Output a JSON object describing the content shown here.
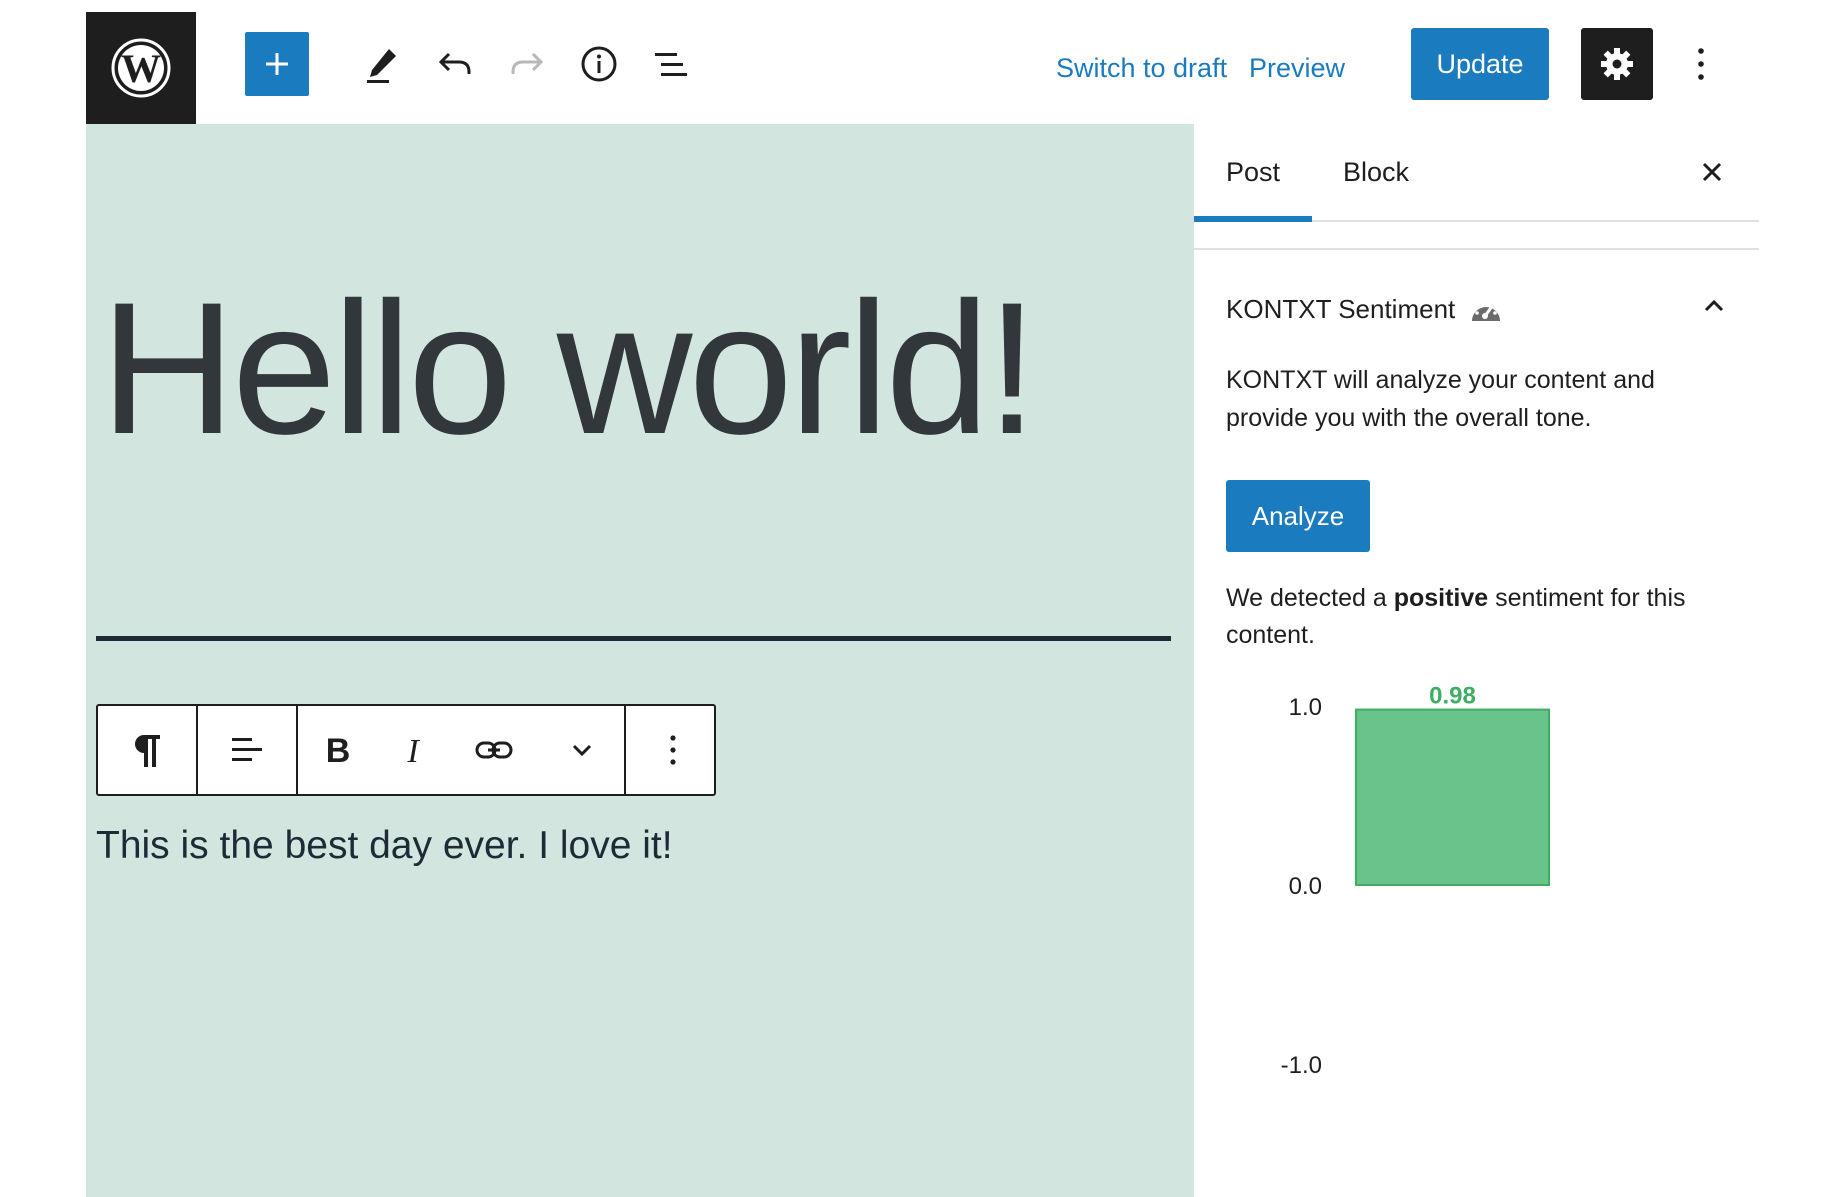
{
  "toolbar": {
    "switch_to_draft": "Switch to draft",
    "preview": "Preview",
    "update": "Update",
    "icons": [
      "wordpress-logo",
      "add-block-icon",
      "tools-pencil-icon",
      "undo-icon",
      "redo-icon",
      "details-info-icon",
      "list-view-icon",
      "settings-gear-icon",
      "more-options-icon"
    ]
  },
  "editor": {
    "post_title": "Hello world!",
    "paragraph": "This is the best day ever. I love it!",
    "block_toolbar_icons": [
      "paragraph-icon",
      "align-icon",
      "bold-icon",
      "italic-icon",
      "link-icon",
      "more-rich-text-icon",
      "block-options-icon"
    ]
  },
  "sidebar": {
    "tabs": [
      {
        "label": "Post",
        "active": true
      },
      {
        "label": "Block",
        "active": false
      }
    ],
    "panel": {
      "title": "KONTXT Sentiment",
      "description": "KONTXT will analyze your content and provide you with the overall tone.",
      "analyze_label": "Analyze",
      "result_prefix": "We detected a",
      "result_sentiment": "positive",
      "result_suffix": "sentiment for this content."
    }
  },
  "colors": {
    "accent": "#1a7bbf",
    "canvas_bg": "#d2e5df",
    "bar_fill": "#68c48a",
    "bar_stroke": "#3fad63",
    "value_label": "#3fad63"
  },
  "chart_data": {
    "type": "bar",
    "categories": [
      ""
    ],
    "values": [
      0.98
    ],
    "data_labels": [
      "0.98"
    ],
    "ylim": [
      -1.0,
      1.0
    ],
    "y_ticks": [
      "1.0",
      "0.0",
      "-1.0"
    ],
    "title": "",
    "xlabel": "",
    "ylabel": "",
    "grid": false
  }
}
